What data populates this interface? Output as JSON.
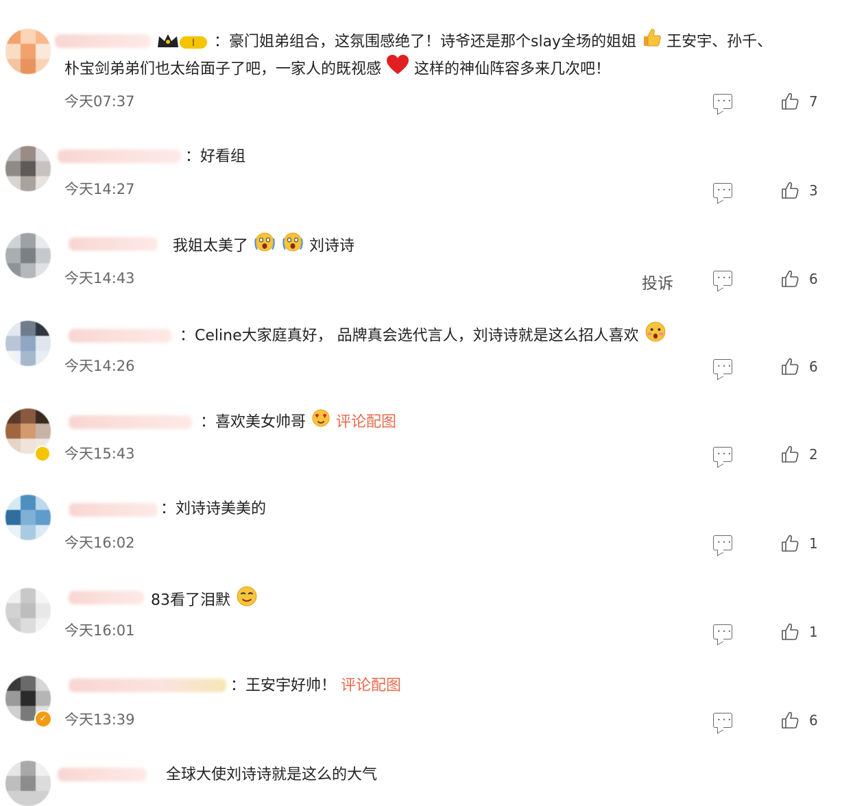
{
  "comments": [
    {
      "text_parts": [
        "：豪门姐弟组合，这氛围感绝了！诗爷还是那个slay全场的姐姐",
        "王安宇、孙千、",
        "朴宝剑弟弟们也太给面子了吧，一家人的既视感",
        "这样的神仙阵容多来几次吧！"
      ],
      "time": "今天07:37",
      "likes": "7"
    },
    {
      "text": "：好看组",
      "time": "今天14:27",
      "likes": "3"
    },
    {
      "text_parts": [
        "我姐太美了",
        "刘诗诗"
      ],
      "time": "今天14:43",
      "likes": "6",
      "report_label": "投诉"
    },
    {
      "text": "：Celine大家庭真好， 品牌真会选代言人，刘诗诗就是这么招人喜欢",
      "time": "今天14:26",
      "likes": "6"
    },
    {
      "text": "：喜欢美女帅哥",
      "link": "评论配图",
      "time": "今天15:43",
      "likes": "2"
    },
    {
      "text": "：刘诗诗美美的",
      "time": "今天16:02",
      "likes": "1"
    },
    {
      "text": "83看了泪默",
      "time": "今天16:01",
      "likes": "1"
    },
    {
      "text": "：王安宇好帅！",
      "link": "评论配图",
      "time": "今天13:39",
      "likes": "6"
    },
    {
      "text": "全球大使刘诗诗就是这么的大气"
    }
  ],
  "badge": {
    "level": "I"
  },
  "colors": {
    "accent": "#e86a4b",
    "heart": "#e02020",
    "muted": "#666666"
  },
  "icons": [
    "reply-icon",
    "like-icon",
    "crown-icon",
    "thumbs-up-emoji",
    "heart-emoji",
    "shocked-emoji",
    "blush-emoji",
    "smile-emoji",
    "love-emoji",
    "verified-icon"
  ]
}
